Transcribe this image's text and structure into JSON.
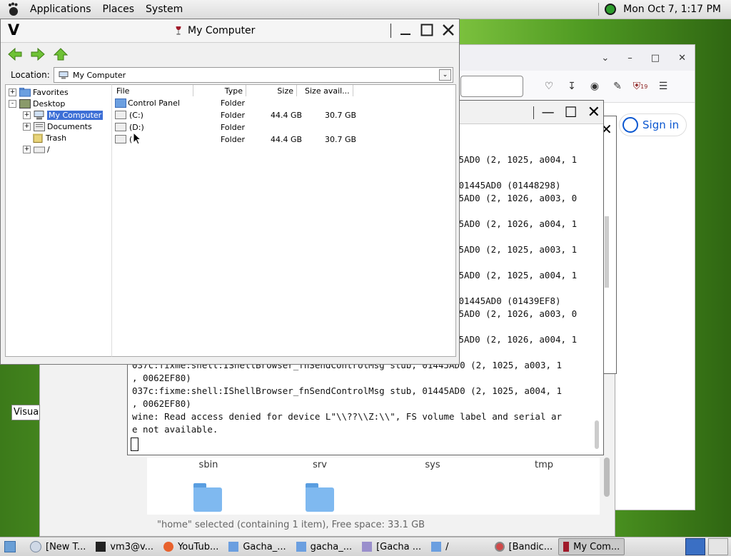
{
  "top_panel": {
    "menus": [
      "Applications",
      "Places",
      "System"
    ],
    "clock": "Mon Oct  7,  1:17 PM"
  },
  "firefox": {
    "sign_in": "Sign in",
    "badge": "19"
  },
  "nautilus": {
    "folders": [
      "sbin",
      "srv",
      "sys",
      "tmp"
    ],
    "status": "\"home\" selected (containing 1 item), Free space: 33.1 GB"
  },
  "tooltip": "Visua",
  "terminal": {
    "lines": [
      "45AD0 (2, 1025, a004, 1",
      "",
      " 01445AD0 (01448298)",
      "45AD0 (2, 1026, a003, 0",
      "",
      "45AD0 (2, 1026, a004, 1",
      "",
      "45AD0 (2, 1025, a003, 1",
      "",
      "45AD0 (2, 1025, a004, 1",
      "",
      " 01445AD0 (01439EF8)",
      "45AD0 (2, 1026, a003, 0",
      "",
      "45AD0 (2, 1026, a004, 1",
      "",
      "037c:fixme:shell:IShellBrowser_fnSendControlMsg stub, 01445AD0 (2, 1025, a003, 1",
      ", 0062EF80)",
      "037c:fixme:shell:IShellBrowser_fnSendControlMsg stub, 01445AD0 (2, 1025, a004, 1",
      ", 0062EF80)",
      "wine: Read access denied for device L\"\\\\??\\\\Z:\\\\\", FS volume label and serial ar",
      "e not available."
    ]
  },
  "wine": {
    "title": "My Computer",
    "location_label": "Location:",
    "location_value": "My Computer",
    "tree": [
      {
        "label": "Favorites",
        "expander": "+"
      },
      {
        "label": "Desktop",
        "expander": "-"
      },
      {
        "label": "My Computer",
        "expander": "+"
      },
      {
        "label": "Documents",
        "expander": "+"
      },
      {
        "label": "Trash",
        "expander": ""
      },
      {
        "label": "/",
        "expander": "+"
      }
    ],
    "columns": [
      "File",
      "Type",
      "Size",
      "Size avail..."
    ],
    "rows": [
      {
        "file": "Control Panel",
        "type": "Folder",
        "size": "",
        "avail": ""
      },
      {
        "file": "(C:)",
        "type": "Folder",
        "size": "44.4 GB",
        "avail": "30.7 GB"
      },
      {
        "file": "(D:)",
        "type": "Folder",
        "size": "",
        "avail": ""
      },
      {
        "file": "(",
        "type": "Folder",
        "size": "44.4 GB",
        "avail": "30.7 GB"
      }
    ]
  },
  "taskbar": {
    "items": [
      "[New T...",
      "vm3@v...",
      "YouTub...",
      "Gacha_...",
      "gacha_...",
      "[Gacha ...",
      "/",
      "[Bandic...",
      "My Com..."
    ]
  },
  "colors": {
    "selection": "#3d6fd6",
    "folder": "#7fb9f0",
    "sign_in": "#0b57d0"
  }
}
